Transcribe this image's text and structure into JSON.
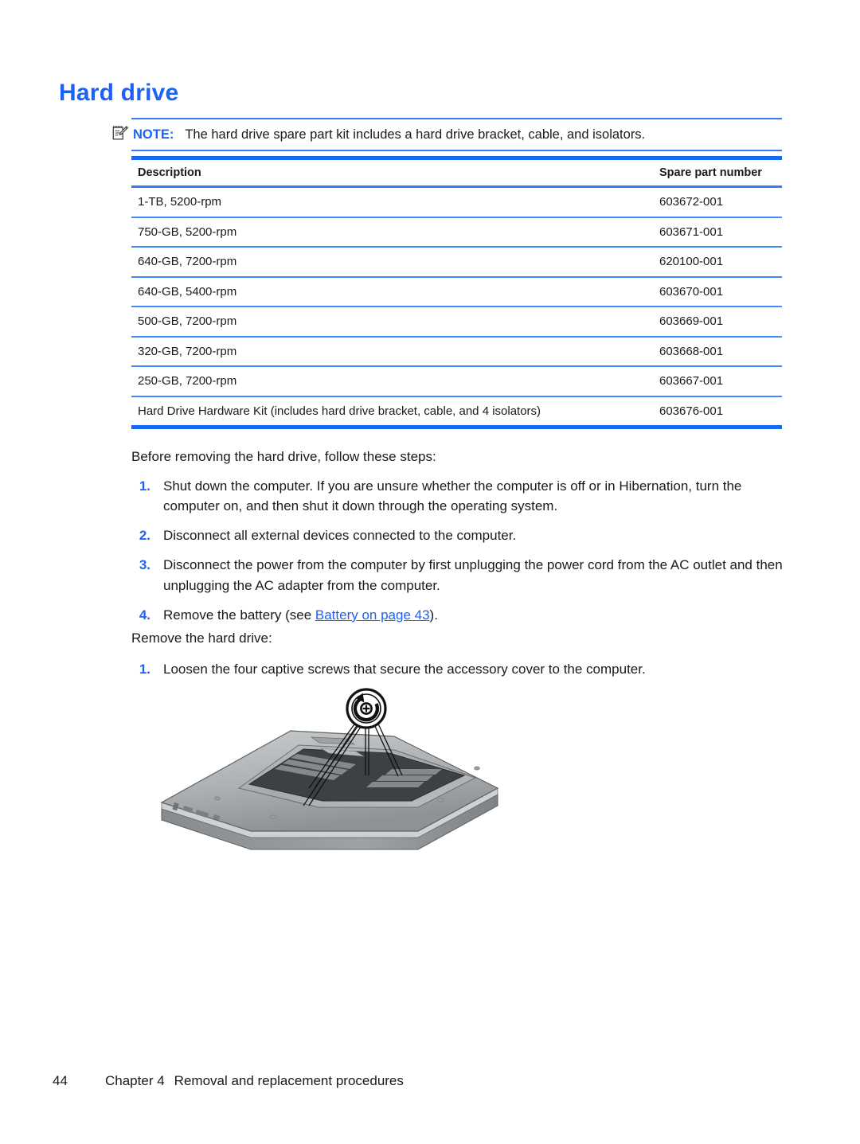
{
  "document": {
    "heading": "Hard drive"
  },
  "note": {
    "icon": "note-pencil-icon",
    "label": "NOTE:",
    "text": "The hard drive spare part kit includes a hard drive bracket, cable, and isolators."
  },
  "table": {
    "headers": {
      "description": "Description",
      "spare_part_number": "Spare part number"
    },
    "rows": [
      {
        "description": "1-TB, 5200-rpm",
        "part": "603672-001"
      },
      {
        "description": "750-GB, 5200-rpm",
        "part": "603671-001"
      },
      {
        "description": "640-GB, 7200-rpm",
        "part": "620100-001"
      },
      {
        "description": "640-GB, 5400-rpm",
        "part": "603670-001"
      },
      {
        "description": "500-GB, 7200-rpm",
        "part": "603669-001"
      },
      {
        "description": "320-GB, 7200-rpm",
        "part": "603668-001"
      },
      {
        "description": "250-GB, 7200-rpm",
        "part": "603667-001"
      },
      {
        "description": "Hard Drive Hardware Kit (includes hard drive bracket, cable, and 4 isolators)",
        "part": "603676-001"
      }
    ]
  },
  "body": {
    "intro_before": "Before removing the hard drive, follow these steps:",
    "steps_before": [
      {
        "num": "1.",
        "text": "Shut down the computer. If you are unsure whether the computer is off or in Hibernation, turn the computer on, and then shut it down through the operating system."
      },
      {
        "num": "2.",
        "text": "Disconnect all external devices connected to the computer."
      },
      {
        "num": "3.",
        "text": "Disconnect the power from the computer by first unplugging the power cord from the AC outlet and then unplugging the AC adapter from the computer."
      }
    ],
    "step4": {
      "num": "4.",
      "prefix": "Remove the battery (see ",
      "link": "Battery on page 43",
      "suffix": ")."
    },
    "intro_remove": "Remove the hard drive:",
    "steps_remove": [
      {
        "num": "1.",
        "text": "Loosen the four captive screws that secure the accessory cover to the computer."
      }
    ]
  },
  "illustration": {
    "name": "laptop-bottom-accessory-cover-screws",
    "callout": "counterclockwise-screw-icon"
  },
  "footer": {
    "page_number": "44",
    "chapter": "Chapter 4",
    "title": "Removal and replacement procedures"
  },
  "colors": {
    "heading_blue": "#1c62f5",
    "rule_blue": "#3c8cfc",
    "rule_blue_thick": "#1569f0",
    "text": "#1a1a1a"
  }
}
